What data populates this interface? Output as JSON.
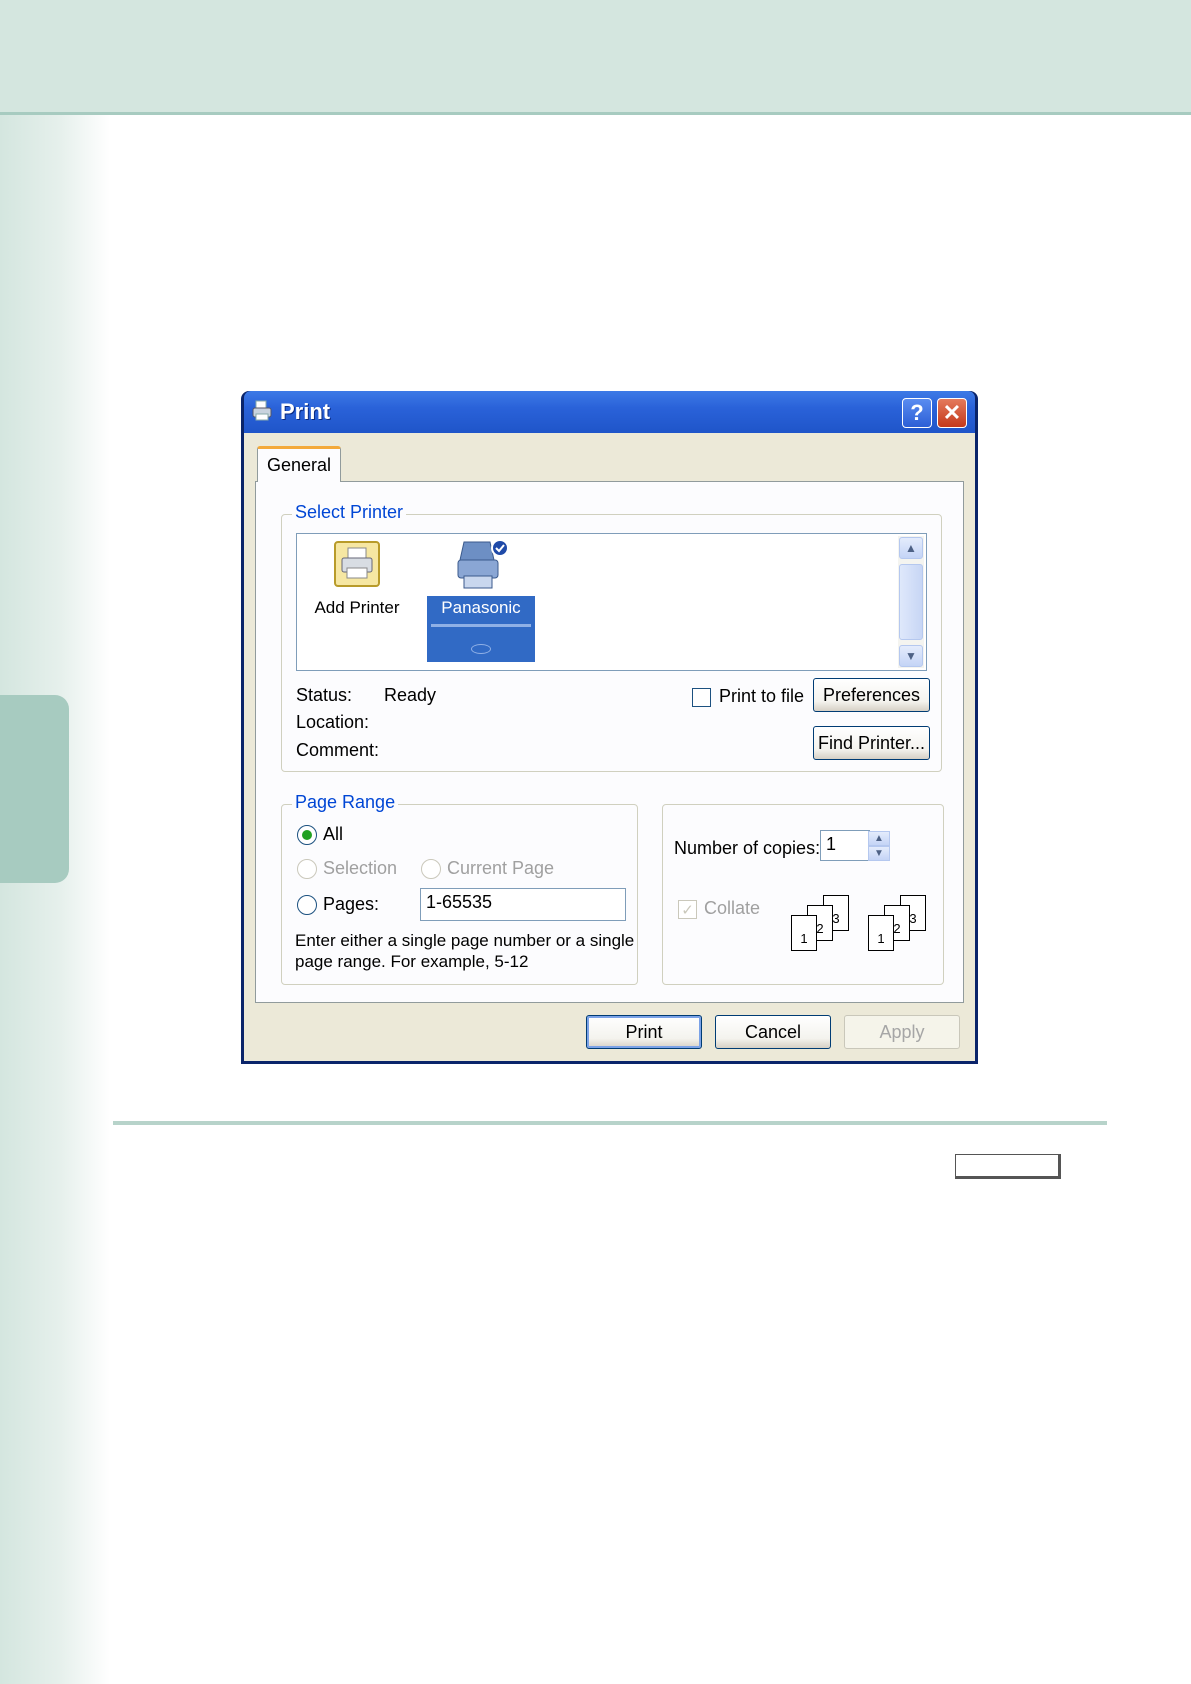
{
  "dialog": {
    "title": "Print",
    "help_glyph": "?",
    "close_glyph": "✕",
    "tab_label": "General",
    "select_printer": {
      "group_label": "Select Printer",
      "printers": [
        {
          "label": "Add Printer"
        },
        {
          "label": "Panasonic"
        }
      ],
      "status_label": "Status:",
      "status_value": "Ready",
      "location_label": "Location:",
      "comment_label": "Comment:",
      "print_to_file_label": "Print to file",
      "preferences_button": "Preferences",
      "find_printer_button": "Find Printer..."
    },
    "page_range": {
      "group_label": "Page Range",
      "all_label": "All",
      "selection_label": "Selection",
      "current_page_label": "Current Page",
      "pages_label": "Pages:",
      "pages_value": "1-65535",
      "hint_line1": "Enter either a single page number or a single",
      "hint_line2": "page range.  For example, 5-12"
    },
    "copies": {
      "label": "Number of copies:",
      "value": "1",
      "collate_label": "Collate",
      "collate_pages": [
        "1",
        "2",
        "3"
      ]
    },
    "buttons": {
      "print": "Print",
      "cancel": "Cancel",
      "apply": "Apply"
    }
  },
  "colors": {
    "page_band": "#d4e6df",
    "page_accent": "#a7cbc0",
    "title_bar": "#2a62d9",
    "dialog_face": "#ece9d8",
    "group_label": "#0046d5",
    "selected_item": "#316ac5"
  }
}
